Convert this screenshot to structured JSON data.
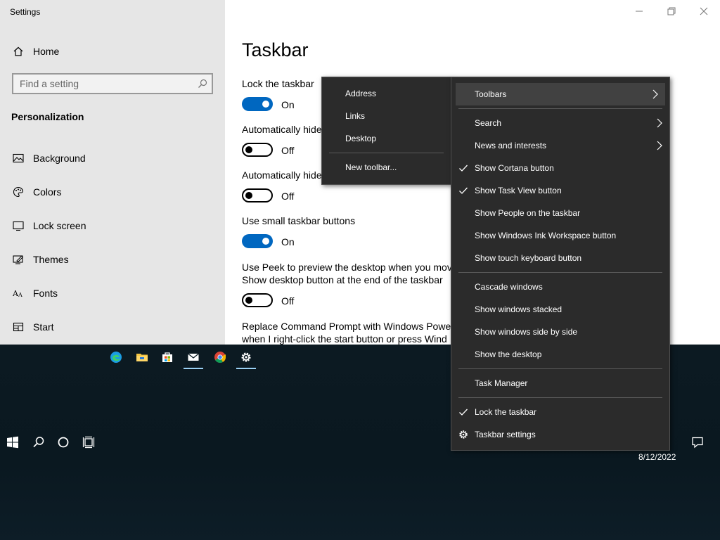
{
  "window": {
    "title": "Settings"
  },
  "sidebar": {
    "home_label": "Home",
    "search_placeholder": "Find a setting",
    "section_title": "Personalization",
    "items": [
      {
        "label": "Background",
        "icon": "image-icon"
      },
      {
        "label": "Colors",
        "icon": "palette-icon"
      },
      {
        "label": "Lock screen",
        "icon": "monitor-icon"
      },
      {
        "label": "Themes",
        "icon": "pen-monitor-icon"
      },
      {
        "label": "Fonts",
        "icon": "font-icon"
      },
      {
        "label": "Start",
        "icon": "start-icon"
      }
    ]
  },
  "main": {
    "page_title": "Taskbar",
    "settings": [
      {
        "label": "Lock the taskbar",
        "state": "On",
        "on": true
      },
      {
        "label": "Automatically hide",
        "state": "Off",
        "on": false
      },
      {
        "label": "Automatically hide",
        "state": "Off",
        "on": false
      },
      {
        "label": "Use small taskbar buttons",
        "state": "On",
        "on": true
      },
      {
        "label_line1": "Use Peek to preview the desktop when you mov",
        "label_line2": "Show desktop button at the end of the taskbar",
        "state": "Off",
        "on": false
      },
      {
        "label_line1": "Replace Command Prompt with Windows Powe",
        "label_line2": "when I right-click the start button or press Wind"
      }
    ]
  },
  "toolbars_submenu": {
    "items": [
      "Address",
      "Links",
      "Desktop"
    ],
    "new_toolbar": "New toolbar..."
  },
  "context_menu": {
    "toolbars": "Toolbars",
    "search": "Search",
    "news": "News and interests",
    "show_cortana": "Show Cortana button",
    "show_task_view": "Show Task View button",
    "show_people": "Show People on the taskbar",
    "show_ink": "Show Windows Ink Workspace button",
    "show_touch": "Show touch keyboard button",
    "cascade": "Cascade windows",
    "stacked": "Show windows stacked",
    "side_by_side": "Show windows side by side",
    "show_desktop": "Show the desktop",
    "task_manager": "Task Manager",
    "lock_taskbar": "Lock the taskbar",
    "taskbar_settings": "Taskbar settings"
  },
  "taskbar": {
    "date": "8/12/2022",
    "apps": [
      "edge-icon",
      "file-explorer-icon",
      "store-icon",
      "mail-icon",
      "chrome-icon",
      "settings-gear-icon"
    ]
  },
  "colors": {
    "accent": "#0067c0",
    "menu_bg": "#2b2b2b",
    "highlight": "#414141"
  }
}
